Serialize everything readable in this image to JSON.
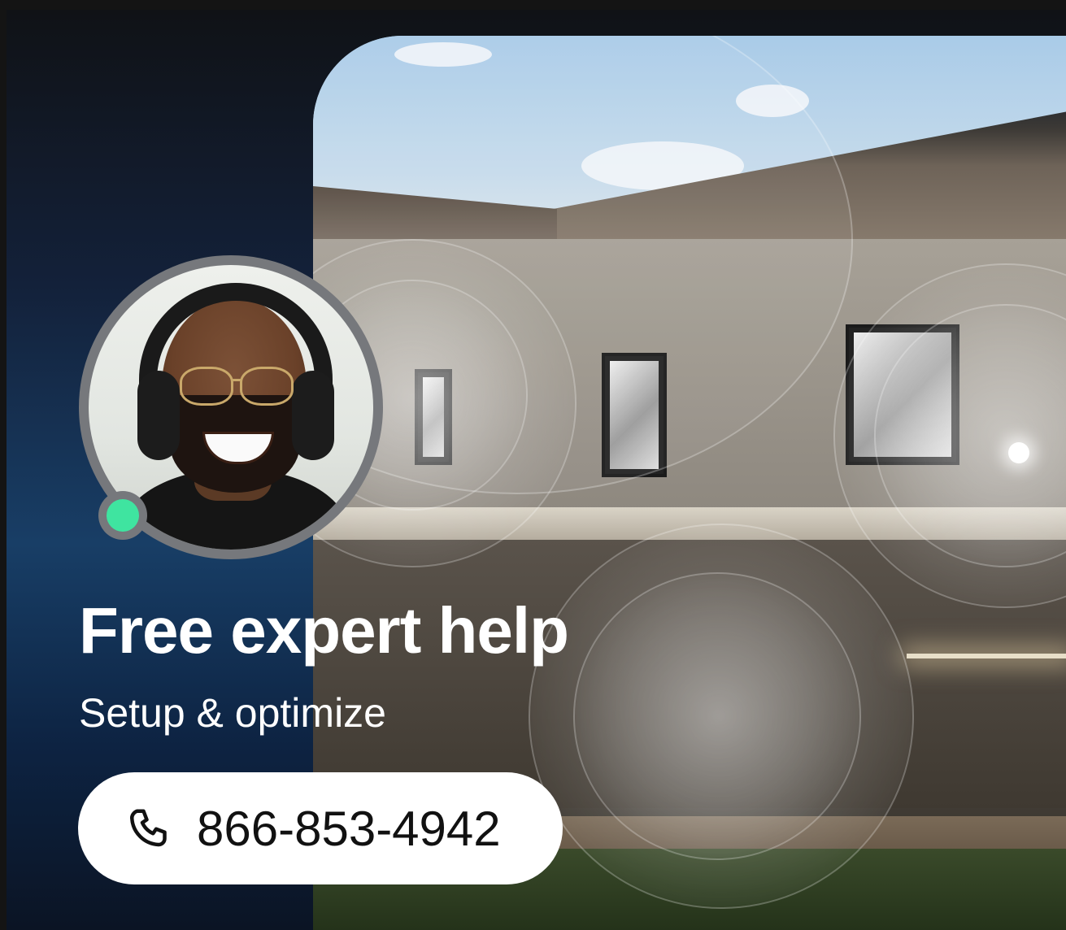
{
  "promo": {
    "title": "Free expert help",
    "subtitle": "Setup & optimize",
    "phone_number": "866-853-4942"
  },
  "agent": {
    "status": "online",
    "status_color": "#3fe4a0"
  },
  "icons": {
    "call_button": "phone-icon",
    "status_indicator": "online-dot-icon"
  },
  "colors": {
    "background_top": "#101216",
    "background_mid": "#183e66",
    "button_bg": "#ffffff",
    "button_text": "#111111",
    "heading_text": "#ffffff"
  }
}
